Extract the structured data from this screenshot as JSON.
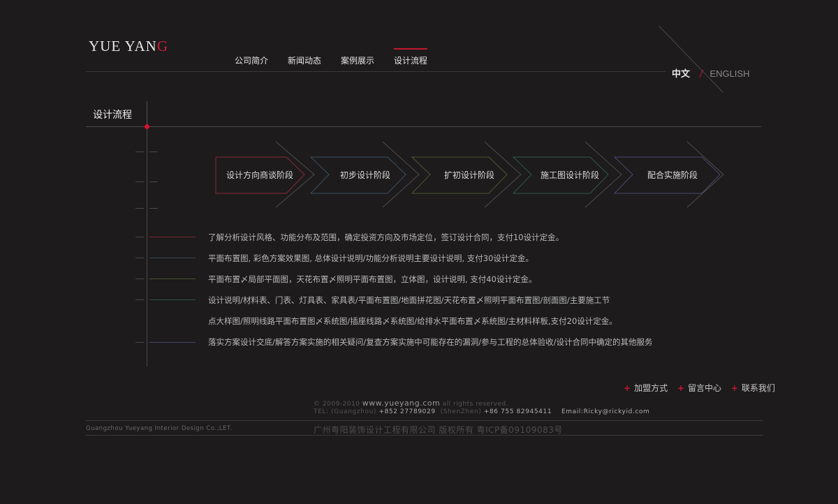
{
  "logo": {
    "text_main": "YUE YAN",
    "text_accent": "G"
  },
  "nav": {
    "items": [
      "公司简介",
      "新闻动态",
      "案例展示",
      "设计流程"
    ],
    "active_index": 3
  },
  "lang": {
    "zh": "中文",
    "separator": "/",
    "en": "ENGLISH"
  },
  "page_title": "设计流程",
  "stages": [
    {
      "label": "设计方向商谈阶段",
      "color": "#8c2a3a"
    },
    {
      "label": "初步设计阶段",
      "color": "#3d5060"
    },
    {
      "label": "扩初设计阶段",
      "color": "#4a5a30"
    },
    {
      "label": "施工图设计阶段",
      "color": "#2f5a4a"
    },
    {
      "label": "配合实施阶段",
      "color": "#4a4a70"
    }
  ],
  "descriptions": [
    {
      "text": "了解分析设计风格、功能分布及范围，确定投资方向及市场定位，签订设计合同，支付10设计定金。",
      "color": "#7c2432"
    },
    {
      "text": "平面布置图,  彩色方案效果图,  总体设计说明/功能分析说明主要设计说明,   支付30设计定金。",
      "color": "#37495a"
    },
    {
      "text": "平面布置〆局部平面图，天花布置〆照明平面布置图，立体图，设计说明,   支付40设计定金。",
      "color": "#4a5630"
    },
    {
      "text": "设计说明/材料表、门表、灯具表、家具表/平面布置图/地面拼花图/天花布置〆照明平面布置图/剖面图/主要施工节",
      "color": "#2f5446"
    },
    {
      "text": "点大样图/照明线路平面布置图〆系统图/插座线路〆系统图/给排水平面布置〆系统图/主材料样板,支付20设计定金。",
      "color": ""
    },
    {
      "text": "落实方案设计交底/解答方案实施的相关疑问/复查方案实施中可能存在的漏洞/参与工程的总体验收/设计合同中确定的其他服务",
      "color": "#44446a"
    }
  ],
  "footer": {
    "links": [
      "加盟方式",
      "留言中心",
      "联系我们"
    ],
    "copyright_prefix": "© 2009-2010",
    "site": "www.yueyang.com",
    "rights": "all rights reserved.",
    "tel_label": "TEL:",
    "city1": "(Guangzhou)",
    "phone1": "+852 27789029",
    "city2": "(ShenZhen)",
    "phone2": "+86 755 82945411",
    "email": "Email:Ricky@rickyid.com",
    "company_en": "Guangzhou Yueyang Interior Design Co.,LET.",
    "company_cn": "广州粤阳装饰设计工程有限公司 版权所有 粤ICP备09109083号"
  }
}
